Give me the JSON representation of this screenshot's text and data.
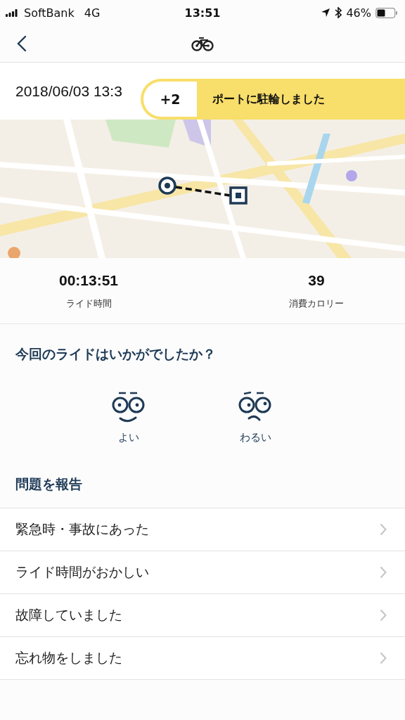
{
  "status_bar": {
    "carrier": "SoftBank",
    "network": "4G",
    "time": "13:51",
    "battery": "46%"
  },
  "ride": {
    "datetime": "2018/06/03 13:3"
  },
  "toast": {
    "badge": "+2",
    "message": "ポートに駐輪しました"
  },
  "stats": [
    {
      "value": "00:13:51",
      "label": "ライド時間"
    },
    {
      "value": "39",
      "label": "消費カロリー"
    }
  ],
  "rating": {
    "question": "今回のライドはいかがでしたか？",
    "options": [
      {
        "kind": "good",
        "label": "よい"
      },
      {
        "kind": "bad",
        "label": "わるい"
      }
    ]
  },
  "report": {
    "title": "問題を報告",
    "items": [
      "緊急時・事故にあった",
      "ライド時間がおかしい",
      "故障していました",
      "忘れ物をしました"
    ]
  }
}
